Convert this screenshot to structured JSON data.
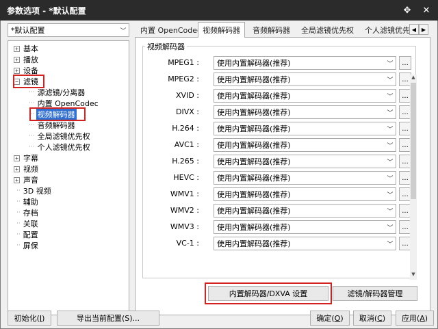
{
  "window": {
    "title": "参数选项 - *默认配置",
    "pin_glyph": "✥",
    "close_glyph": "✕"
  },
  "profile": {
    "selected": "*默认配置"
  },
  "tree": {
    "items": [
      {
        "label": "基本",
        "expander": "+"
      },
      {
        "label": "播放",
        "expander": "+"
      },
      {
        "label": "设备",
        "expander": "+"
      },
      {
        "label": "滤镜",
        "expander": "−"
      },
      {
        "label": "源滤镜/分离器"
      },
      {
        "label": "内置 OpenCodec"
      },
      {
        "label": "视频解码器",
        "selected": true
      },
      {
        "label": "音频解码器"
      },
      {
        "label": "全局滤镜优先权"
      },
      {
        "label": "个人滤镜优先权"
      },
      {
        "label": "字幕",
        "expander": "+"
      },
      {
        "label": "视频",
        "expander": "+"
      },
      {
        "label": "声音",
        "expander": "+"
      },
      {
        "label": "3D 视频"
      },
      {
        "label": "辅助"
      },
      {
        "label": "存档"
      },
      {
        "label": "关联"
      },
      {
        "label": "配置"
      },
      {
        "label": "屏保"
      }
    ]
  },
  "tabs": [
    "内置 OpenCodec",
    "视频解码器",
    "音频解码器",
    "全局滤镜优先权",
    "个人滤镜优先"
  ],
  "active_tab": "视频解码器",
  "group": {
    "title": "视频解码器",
    "decoders": [
      {
        "name": "MPEG1 :",
        "value": "使用内置解码器(推荐)"
      },
      {
        "name": "MPEG2 :",
        "value": "使用内置解码器(推荐)"
      },
      {
        "name": "XVID :",
        "value": "使用内置解码器(推荐)"
      },
      {
        "name": "DIVX :",
        "value": "使用内置解码器(推荐)"
      },
      {
        "name": "H.264 :",
        "value": "使用内置解码器(推荐)"
      },
      {
        "name": "AVC1 :",
        "value": "使用内置解码器(推荐)"
      },
      {
        "name": "H.265 :",
        "value": "使用内置解码器(推荐)"
      },
      {
        "name": "HEVC :",
        "value": "使用内置解码器(推荐)"
      },
      {
        "name": "WMV1 :",
        "value": "使用内置解码器(推荐)"
      },
      {
        "name": "WMV2 :",
        "value": "使用内置解码器(推荐)"
      },
      {
        "name": "WMV3 :",
        "value": "使用内置解码器(推荐)"
      },
      {
        "name": "VC-1 :",
        "value": "使用内置解码器(推荐)"
      }
    ],
    "more_label": "..."
  },
  "buttons": {
    "dxva": "内置解码器/DXVA 设置",
    "filter_manage": "滤镜/解码器管理",
    "init_pre": "初始化(",
    "init_key": "I",
    "init_post": ")",
    "export": "导出当前配置(S)...",
    "ok_pre": "确定(",
    "ok_key": "O",
    "ok_post": ")",
    "cancel_pre": "取消(",
    "cancel_key": "C",
    "cancel_post": ")",
    "apply_pre": "应用(",
    "apply_key": "A",
    "apply_post": ")"
  },
  "colors": {
    "highlight_red": "#d32020",
    "selection_blue": "#2f6fd0"
  }
}
